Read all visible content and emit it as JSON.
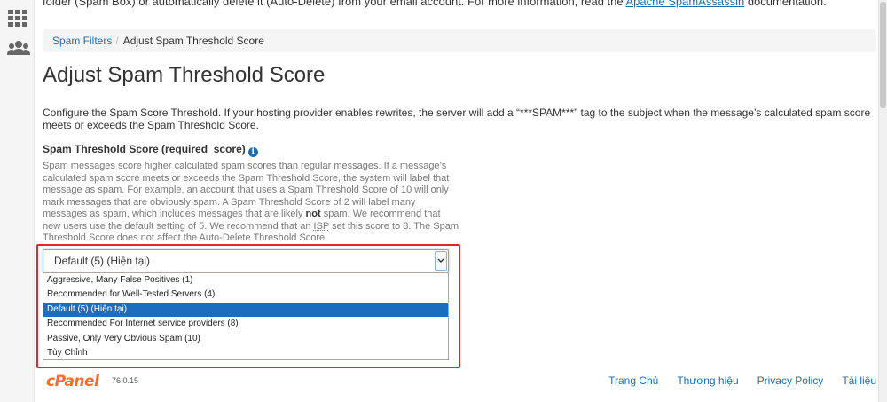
{
  "intro": {
    "prefix": "folder (Spam Box) or automatically delete it (Auto-Delete) from your email account. For more information, read the ",
    "link": "Apache SpamAssassin",
    "suffix": " documentation."
  },
  "breadcrumb": {
    "parent": "Spam Filters",
    "separator": "/",
    "current": "Adjust Spam Threshold Score"
  },
  "page_title": "Adjust Spam Threshold Score",
  "description": "Configure the Spam Score Threshold. If your hosting provider enables rewrites, the server will add a “***SPAM***” tag to the subject when the message’s calculated spam score meets or exceeds the Spam Threshold Score.",
  "field": {
    "label": "Spam Threshold Score (required_score)",
    "info_icon": "i",
    "help_part1": "Spam messages score higher calculated spam scores than regular messages. If a message’s calculated spam score meets or exceeds the Spam Threshold Score, the system will label that message as spam. For example, an account that uses a Spam Threshold Score of 10 will only mark messages that are obviously spam. A Spam Threshold Score of 2 will label many messages as spam, which includes messages that are likely ",
    "help_bold": "not",
    "help_part2": " spam. We recommend that new users use the default setting of 5. We recommend that an ",
    "help_abbr": "ISP",
    "help_part3": " set this score to 8. The Spam Threshold Score does not affect the Auto-Delete Threshold Score."
  },
  "select": {
    "value": "Default (5) (Hiện tại)",
    "options": [
      "Aggressive, Many False Positives (1)",
      "Recommended for Well-Tested Servers (4)",
      "Default (5) (Hiện tại)",
      "Recommended For Internet service providers (8)",
      "Passive, Only Very Obvious Spam (10)",
      "Tùy Chỉnh"
    ],
    "selected_index": 2
  },
  "footer": {
    "logo": "cPanel",
    "version": "76.0.15",
    "links": [
      "Trang Chủ",
      "Thương hiệu",
      "Privacy Policy",
      "Tài liệu"
    ]
  },
  "colors": {
    "link": "#1b6fad",
    "highlight_border": "#e3262b",
    "selected_option": "#1c6dc2",
    "logo": "#ff6c2c"
  },
  "icons": {
    "rail": [
      "apps-grid-icon",
      "users-icon"
    ],
    "field": "info-icon",
    "select": "chevron-down-icon"
  }
}
